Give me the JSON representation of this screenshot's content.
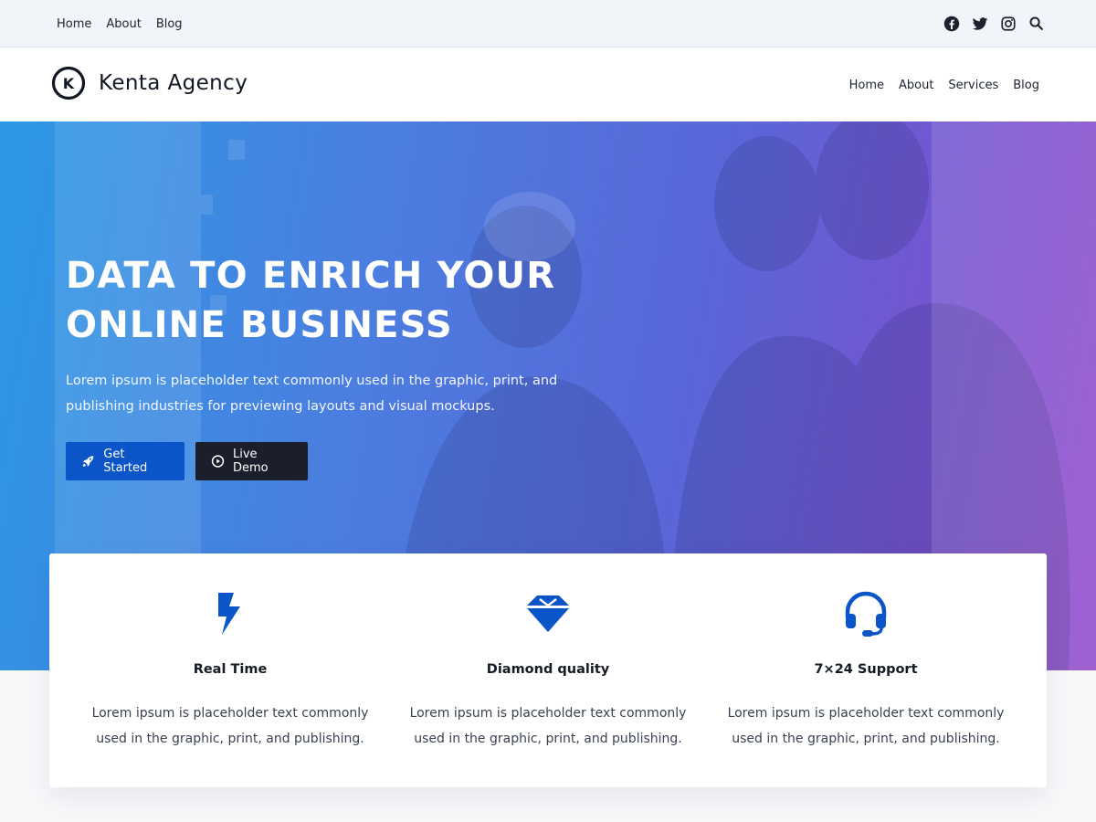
{
  "topbar": {
    "links": [
      "Home",
      "About",
      "Blog"
    ],
    "social_icons": [
      "facebook-icon",
      "twitter-icon",
      "instagram-icon",
      "search-icon"
    ]
  },
  "header": {
    "brand": "Kenta Agency",
    "logo_letter": "K",
    "nav": [
      "Home",
      "About",
      "Services",
      "Blog"
    ]
  },
  "hero": {
    "title_line1": "DATA TO ENRICH YOUR",
    "title_line2": "ONLINE BUSINESS",
    "description": "Lorem ipsum is placeholder text commonly used in the graphic, print, and publishing industries for previewing layouts and visual mockups.",
    "primary_button": "Get Started",
    "secondary_button": "Live Demo",
    "gradient_colors": [
      "#2b98e6",
      "#5a66d8",
      "#934bcb"
    ]
  },
  "features": [
    {
      "icon": "lightning-icon",
      "title": "Real Time",
      "text": "Lorem ipsum is placeholder text commonly used in the graphic, print, and publishing."
    },
    {
      "icon": "diamond-icon",
      "title": "Diamond quality",
      "text": "Lorem ipsum is placeholder text commonly used in the graphic, print, and publishing."
    },
    {
      "icon": "headset-icon",
      "title": "7×24 Support",
      "text": "Lorem ipsum is placeholder text commonly used in the graphic, print, and publishing."
    }
  ],
  "colors": {
    "accent": "#0b55c8",
    "dark_button": "#1a1f2b",
    "topbar_bg": "#f1f4f8"
  }
}
